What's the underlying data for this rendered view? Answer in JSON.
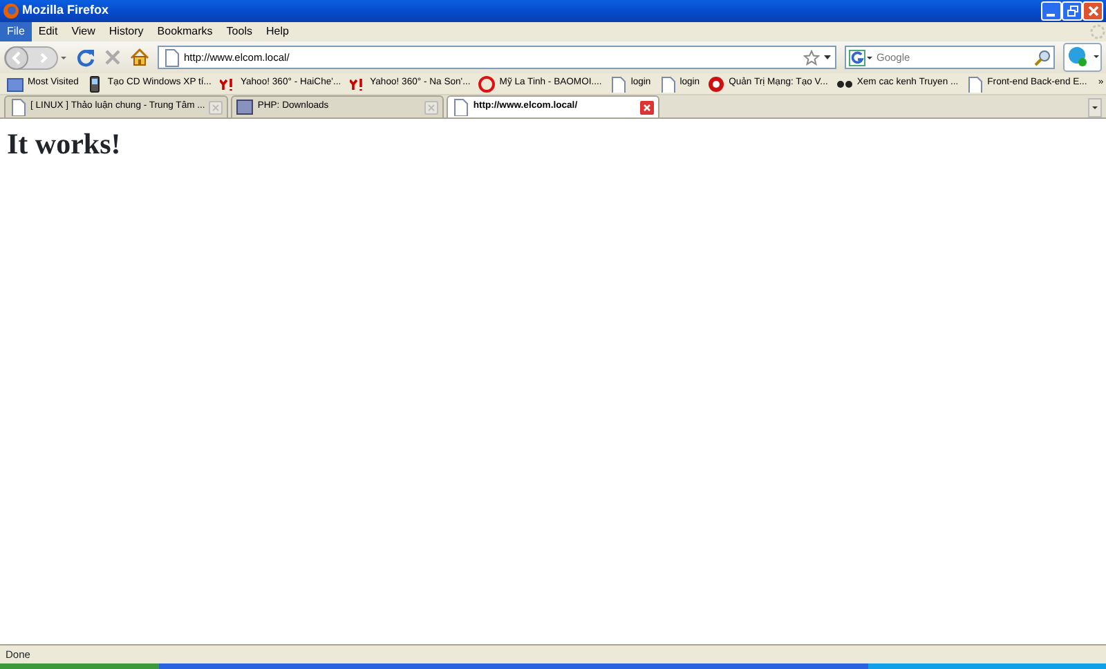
{
  "window": {
    "title": "Mozilla Firefox"
  },
  "menu": [
    {
      "label": "File",
      "selected": true
    },
    {
      "label": "Edit",
      "selected": false
    },
    {
      "label": "View",
      "selected": false
    },
    {
      "label": "History",
      "selected": false
    },
    {
      "label": "Bookmarks",
      "selected": false
    },
    {
      "label": "Tools",
      "selected": false
    },
    {
      "label": "Help",
      "selected": false
    }
  ],
  "address_bar": {
    "value": "http://www.elcom.local/"
  },
  "search": {
    "placeholder": "Google"
  },
  "bookmarks": [
    {
      "label": "Most Visited",
      "kind": "folder"
    },
    {
      "label": "Tạo CD Windows XP tí...",
      "kind": "phone"
    },
    {
      "label": "Yahoo! 360° - HaiChe'...",
      "kind": "yahoo"
    },
    {
      "label": "Yahoo! 360° - Na Son'...",
      "kind": "yahoo"
    },
    {
      "label": "Mỹ La Tinh - BAOMOI....",
      "kind": "baomoi"
    },
    {
      "label": "login",
      "kind": "page"
    },
    {
      "label": "login",
      "kind": "page"
    },
    {
      "label": "Quản Trị Mạng: Tạo V...",
      "kind": "q"
    },
    {
      "label": "Xem cac kenh Truyen ...",
      "kind": "glasses"
    },
    {
      "label": "Front-end Back-end E...",
      "kind": "page"
    }
  ],
  "bookmarks_overflow": "»",
  "tabs": [
    {
      "label": "[ LINUX ] Thảo luận chung - Trung Tâm ...",
      "kind": "doc",
      "selected": false
    },
    {
      "label": "PHP: Downloads",
      "kind": "php",
      "selected": false
    },
    {
      "label": "http://www.elcom.local/",
      "kind": "page",
      "selected": true
    }
  ],
  "page": {
    "heading": "It works!"
  },
  "status_bar": {
    "text": "Done"
  }
}
